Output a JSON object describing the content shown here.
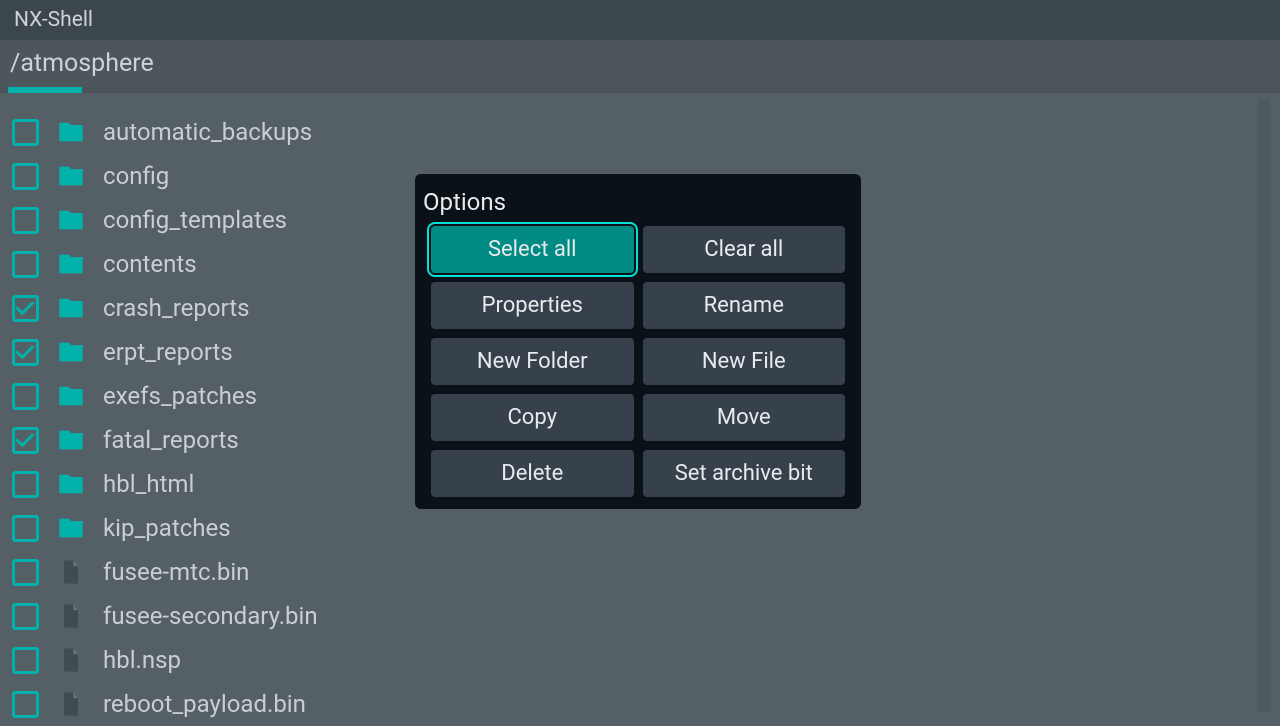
{
  "title": "NX-Shell",
  "path": "/atmosphere",
  "accent": "#00b2a9",
  "files": [
    {
      "name": "automatic_backups",
      "type": "folder",
      "checked": false
    },
    {
      "name": "config",
      "type": "folder",
      "checked": false
    },
    {
      "name": "config_templates",
      "type": "folder",
      "checked": false
    },
    {
      "name": "contents",
      "type": "folder",
      "checked": false
    },
    {
      "name": "crash_reports",
      "type": "folder",
      "checked": true
    },
    {
      "name": "erpt_reports",
      "type": "folder",
      "checked": true
    },
    {
      "name": "exefs_patches",
      "type": "folder",
      "checked": false
    },
    {
      "name": "fatal_reports",
      "type": "folder",
      "checked": true
    },
    {
      "name": "hbl_html",
      "type": "folder",
      "checked": false
    },
    {
      "name": "kip_patches",
      "type": "folder",
      "checked": false
    },
    {
      "name": "fusee-mtc.bin",
      "type": "file",
      "checked": false
    },
    {
      "name": "fusee-secondary.bin",
      "type": "file",
      "checked": false
    },
    {
      "name": "hbl.nsp",
      "type": "file",
      "checked": false
    },
    {
      "name": "reboot_payload.bin",
      "type": "file",
      "checked": false
    }
  ],
  "modal": {
    "title": "Options",
    "buttons": [
      {
        "label": "Select all",
        "selected": true
      },
      {
        "label": "Clear all",
        "selected": false
      },
      {
        "label": "Properties",
        "selected": false
      },
      {
        "label": "Rename",
        "selected": false
      },
      {
        "label": "New Folder",
        "selected": false
      },
      {
        "label": "New File",
        "selected": false
      },
      {
        "label": "Copy",
        "selected": false
      },
      {
        "label": "Move",
        "selected": false
      },
      {
        "label": "Delete",
        "selected": false
      },
      {
        "label": "Set archive bit",
        "selected": false
      }
    ]
  }
}
